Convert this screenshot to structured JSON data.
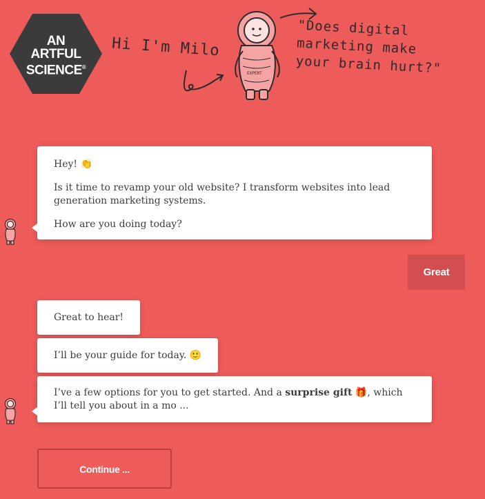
{
  "header": {
    "logo_lines": [
      "AN",
      "ARTFUL",
      "SCIENCE"
    ],
    "logo_mark": "®",
    "greeting": "Hi I'm Milo",
    "mascot_label": "EXPERT",
    "quote_lines": [
      "\"Does digital",
      "marketing make",
      "your brain hurt?\""
    ]
  },
  "chat": {
    "msg1": {
      "greeting": "Hey!",
      "greeting_emoji": "👏",
      "line2": "Is it time to revamp your old website? I transform websites into lead generation marketing systems.",
      "line3": "How are you doing today?"
    },
    "user_reply": "Great",
    "msg2": "Great to hear!",
    "msg3": {
      "text": "I’ll be your guide for today.",
      "emoji": "🙂"
    },
    "msg4": {
      "before": "I’ve a few options for you to get started. And a ",
      "bold": "surprise gift",
      "emoji": "🎁",
      "after": ", which I’ll tell you about in a mo ..."
    },
    "continue_label": "Continue ..."
  },
  "colors": {
    "background": "#ee5b5b",
    "logo_hexagon": "#3b3b3b",
    "reply_button": "#d24e51",
    "continue_border": "#c23b3f"
  },
  "icons": [
    "hexagon-logo",
    "milo-mascot",
    "milo-avatar"
  ]
}
